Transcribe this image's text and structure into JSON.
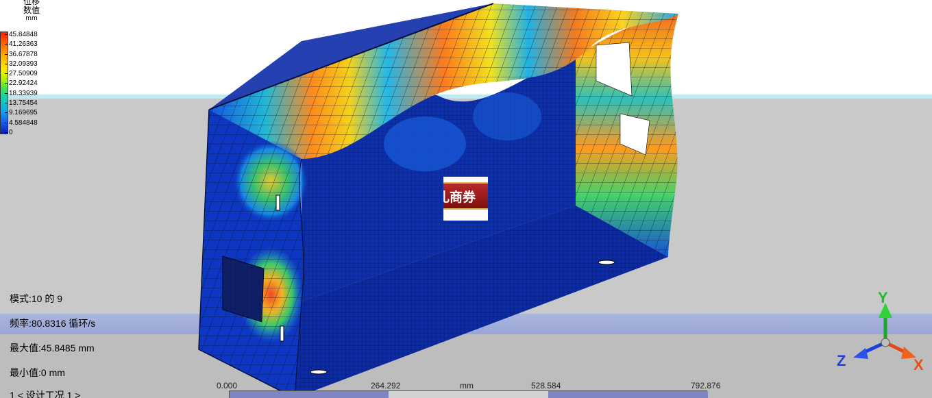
{
  "legend": {
    "title_line1": "位移",
    "title_line2": "数值",
    "unit": "mm",
    "colors": [
      "#ff1a00",
      "#ff6a00",
      "#ffb200",
      "#ffe600",
      "#b8f000",
      "#3ce25a",
      "#10d0b8",
      "#11a6ef",
      "#1456e6",
      "#0a22b4"
    ],
    "labels": [
      "45.84848",
      "41.26363",
      "36.67878",
      "32.09393",
      "27.50909",
      "22.92424",
      "18.33939",
      "13.75454",
      "9.169695",
      "4.584848",
      "0"
    ]
  },
  "info": {
    "mode": "模式:10 的 9",
    "frequency": "频率:80.8316 循环/s",
    "max_value": "最大值:45.8485 mm",
    "min_value": "最小值:0 mm",
    "design_case": "1 < 设计工况 1 >"
  },
  "scale": {
    "ticks": [
      "0.000",
      "264.292",
      "528.584",
      "792.876"
    ],
    "unit": "mm"
  },
  "axes": {
    "y": "Y",
    "z": "Z",
    "x": "X"
  },
  "popup": {
    "text": "礼商券"
  }
}
